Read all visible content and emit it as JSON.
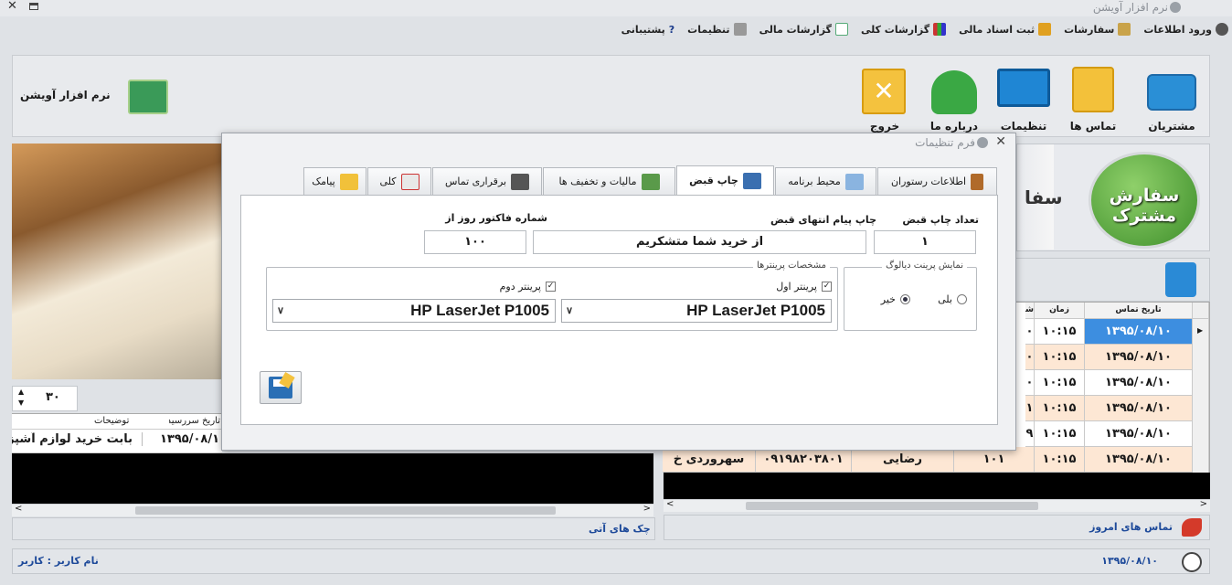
{
  "app": {
    "title": "نرم افزار آویشن",
    "brand": "نرم افزار آویشن"
  },
  "menu": [
    {
      "label": "ورود اطلاعات",
      "icon": "gear-icon"
    },
    {
      "label": "سفارشات",
      "icon": "pencil-icon"
    },
    {
      "label": "ثبت اسناد مالی",
      "icon": "coins-icon"
    },
    {
      "label": "گزارشات کلی",
      "icon": "bar-chart-icon"
    },
    {
      "label": "گزارشات مالی",
      "icon": "report-icon"
    },
    {
      "label": "تنظیمات",
      "icon": "tools-icon"
    },
    {
      "label": "پشتیبانی",
      "icon": "help-icon"
    }
  ],
  "ribbon": {
    "customers": "مشتریان",
    "contacts": "تماس ها",
    "settings": "تنظیمات",
    "about": "درباره ما",
    "exit": "خروج"
  },
  "order": {
    "line1": "سفارش",
    "line2": "مشترک",
    "partial": "سفا"
  },
  "left": {
    "stepper": "۳۰",
    "col_desc": "توضیحات",
    "col_due": "تاریخ سررسید",
    "row_desc": "بابت خرید لوازم آشپز",
    "row_due": "۱۳۹۵/۰۸/۱",
    "footer": "چک های آتی"
  },
  "right": {
    "col_date": "تاریخ تماس",
    "col_time": "زمان",
    "col_s": "شر",
    "rows": [
      {
        "date": "۱۳۹۵/۰۸/۱۰",
        "time": "۱۰:۱۵",
        "x": "۰"
      },
      {
        "date": "۱۳۹۵/۰۸/۱۰",
        "time": "۱۰:۱۵",
        "x": "۰"
      },
      {
        "date": "۱۳۹۵/۰۸/۱۰",
        "time": "۱۰:۱۵",
        "x": "۰"
      },
      {
        "date": "۱۳۹۵/۰۸/۱۰",
        "time": "۱۰:۱۵",
        "x": "۱"
      },
      {
        "date": "۱۳۹۵/۰۸/۱۰",
        "time": "۱۰:۱۵",
        "x": "۹"
      },
      {
        "date": "۱۳۹۵/۰۸/۱۰",
        "time": "۱۰:۱۵",
        "code": "۱۰۱",
        "name": "رضایی",
        "phone": "۰۹۱۹۸۲۰۳۸۰۱",
        "addr": "سهروردی خ"
      }
    ],
    "footer": "تماس های امروز"
  },
  "status": {
    "user": "نام کاربر : کاربر",
    "date": "۱۳۹۵/۰۸/۱۰"
  },
  "dialog": {
    "title": "فرم تنظیمات",
    "tabs": [
      "اطلاعات رستوران",
      "محیط برنامه",
      "چاپ قبض",
      "مالیات و تخفیف ها",
      "برقراری تماس",
      "کلی",
      "پیامک"
    ],
    "print_count_label": "تعداد چاپ قبض",
    "print_count": "۱",
    "footer_msg_label": "چاپ پیام انتهای قبض",
    "footer_msg": "از خرید شما متشکریم",
    "invoice_start_label": "شماره فاکتور روز از",
    "invoice_start": "۱۰۰",
    "dialog_group": "نمایش پرینت دیالوگ",
    "yes": "بلی",
    "no": "خیر",
    "printers_group": "مشخصات پرینترها",
    "printer1_label": "پرینتر اول",
    "printer2_label": "پرینتر دوم",
    "printer1": "HP LaserJet P1005",
    "printer2": "HP LaserJet P1005"
  }
}
